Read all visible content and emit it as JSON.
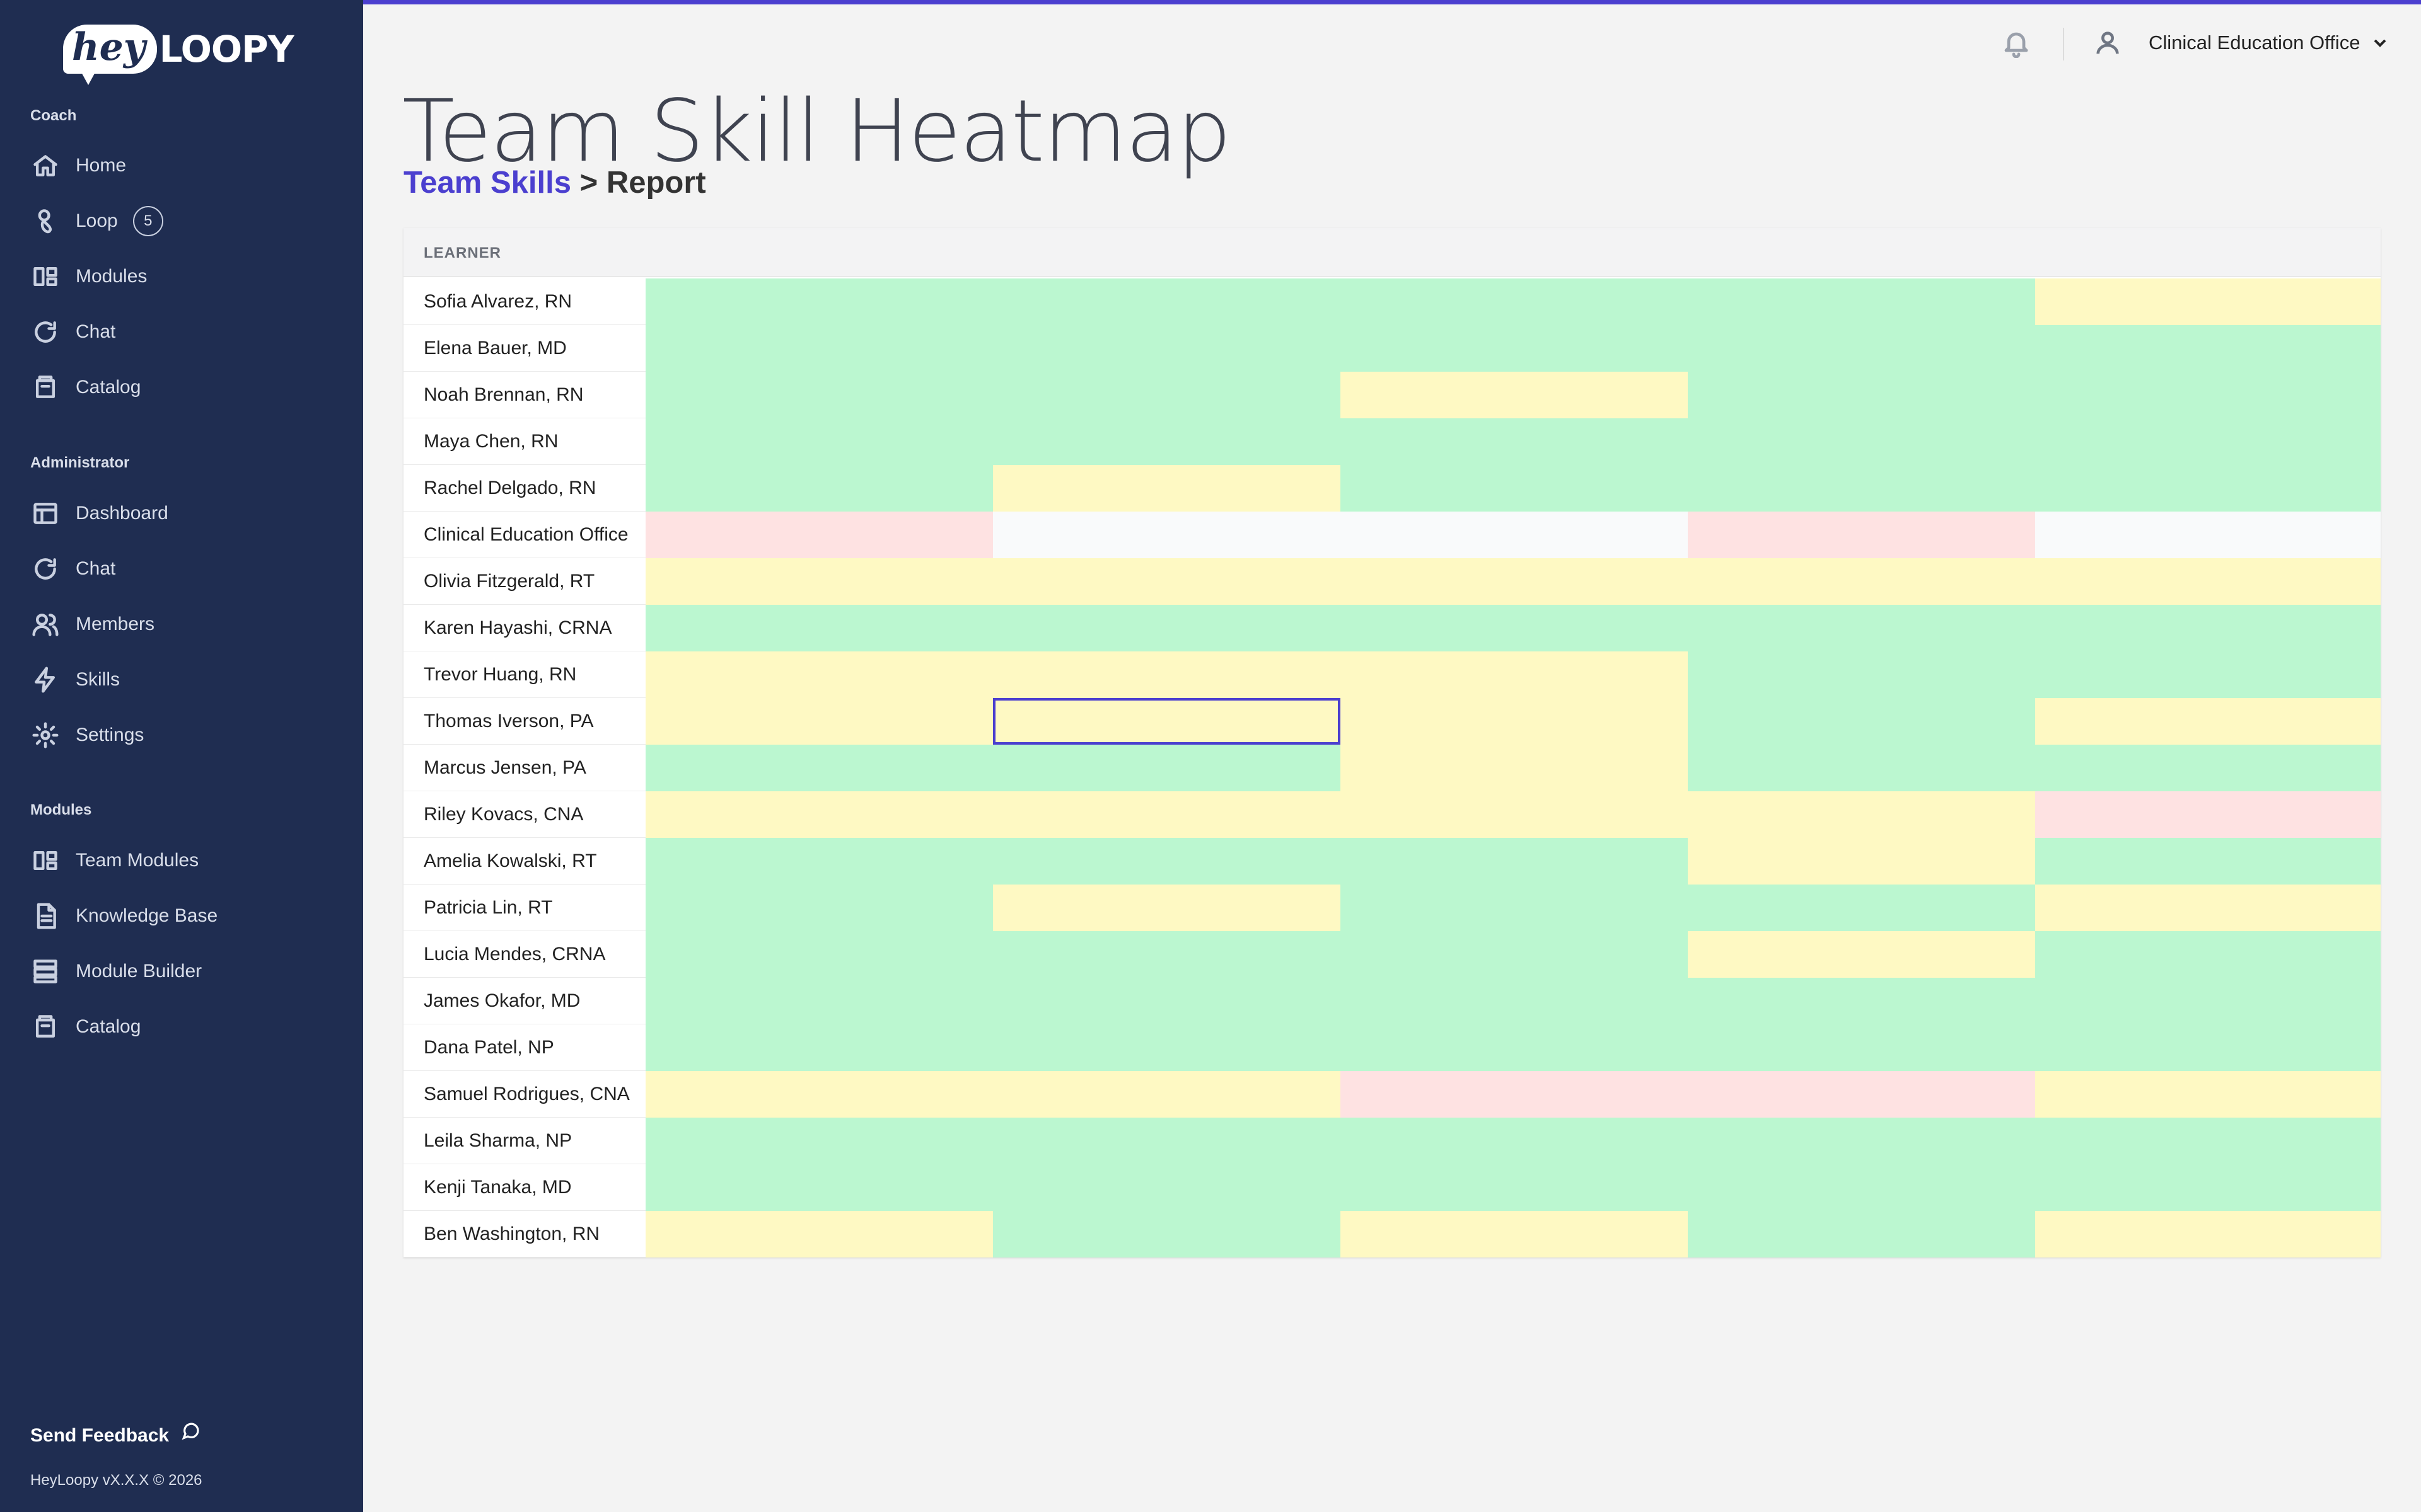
{
  "brand": {
    "hey": "hey",
    "loopy": "LOOPY"
  },
  "sidebar": {
    "sections": [
      {
        "label": "Coach",
        "items": [
          {
            "label": "Home",
            "icon": "home-icon"
          },
          {
            "label": "Loop",
            "icon": "loop-icon",
            "badge": "5"
          },
          {
            "label": "Modules",
            "icon": "modules-icon"
          },
          {
            "label": "Chat",
            "icon": "chat-icon"
          },
          {
            "label": "Catalog",
            "icon": "catalog-icon"
          }
        ]
      },
      {
        "label": "Administrator",
        "items": [
          {
            "label": "Dashboard",
            "icon": "dashboard-icon"
          },
          {
            "label": "Chat",
            "icon": "chat-icon"
          },
          {
            "label": "Members",
            "icon": "members-icon"
          },
          {
            "label": "Skills",
            "icon": "skills-icon"
          },
          {
            "label": "Settings",
            "icon": "gear-icon"
          }
        ]
      },
      {
        "label": "Modules",
        "items": [
          {
            "label": "Team Modules",
            "icon": "modules-icon"
          },
          {
            "label": "Knowledge Base",
            "icon": "document-icon"
          },
          {
            "label": "Module Builder",
            "icon": "builder-icon"
          },
          {
            "label": "Catalog",
            "icon": "catalog-icon"
          }
        ]
      }
    ],
    "feedback_label": "Send Feedback",
    "version": "HeyLoopy vX.X.X © 2026"
  },
  "header": {
    "account_name": "Clinical Education Office"
  },
  "page": {
    "title": "Team Skill Heatmap",
    "breadcrumb_link": "Team Skills",
    "breadcrumb_sep": " > ",
    "breadcrumb_current": "Report"
  },
  "colors": {
    "G": "#bbf7d0",
    "Y": "#fef9c3",
    "R": "#fee2e2",
    "E": "#f9fafb",
    "accent": "#4b3fcf",
    "sidebar": "#1f2d51"
  },
  "heatmap": {
    "learner_header": "LEARNER",
    "selected_cell": {
      "row": 9,
      "col": 1
    },
    "rows": [
      {
        "name": "Sofia Alvarez, RN",
        "cells": [
          "G",
          "G",
          "G",
          "G",
          "Y"
        ]
      },
      {
        "name": "Elena Bauer, MD",
        "cells": [
          "G",
          "G",
          "G",
          "G",
          "G"
        ]
      },
      {
        "name": "Noah Brennan, RN",
        "cells": [
          "G",
          "G",
          "Y",
          "G",
          "G"
        ]
      },
      {
        "name": "Maya Chen, RN",
        "cells": [
          "G",
          "G",
          "G",
          "G",
          "G"
        ]
      },
      {
        "name": "Rachel Delgado, RN",
        "cells": [
          "G",
          "Y",
          "G",
          "G",
          "G"
        ]
      },
      {
        "name": "Clinical Education Office",
        "cells": [
          "R",
          "E",
          "E",
          "R",
          "E"
        ]
      },
      {
        "name": "Olivia Fitzgerald, RT",
        "cells": [
          "Y",
          "Y",
          "Y",
          "Y",
          "Y"
        ]
      },
      {
        "name": "Karen Hayashi, CRNA",
        "cells": [
          "G",
          "G",
          "G",
          "G",
          "G"
        ]
      },
      {
        "name": "Trevor Huang, RN",
        "cells": [
          "Y",
          "Y",
          "Y",
          "G",
          "G"
        ]
      },
      {
        "name": "Thomas Iverson, PA",
        "cells": [
          "Y",
          "Y",
          "Y",
          "G",
          "Y"
        ]
      },
      {
        "name": "Marcus Jensen, PA",
        "cells": [
          "G",
          "G",
          "Y",
          "G",
          "G"
        ]
      },
      {
        "name": "Riley Kovacs, CNA",
        "cells": [
          "Y",
          "Y",
          "Y",
          "Y",
          "R"
        ]
      },
      {
        "name": "Amelia Kowalski, RT",
        "cells": [
          "G",
          "G",
          "G",
          "Y",
          "G"
        ]
      },
      {
        "name": "Patricia Lin, RT",
        "cells": [
          "G",
          "Y",
          "G",
          "G",
          "Y"
        ]
      },
      {
        "name": "Lucia Mendes, CRNA",
        "cells": [
          "G",
          "G",
          "G",
          "Y",
          "G"
        ]
      },
      {
        "name": "James Okafor, MD",
        "cells": [
          "G",
          "G",
          "G",
          "G",
          "G"
        ]
      },
      {
        "name": "Dana Patel, NP",
        "cells": [
          "G",
          "G",
          "G",
          "G",
          "G"
        ]
      },
      {
        "name": "Samuel Rodrigues, CNA",
        "cells": [
          "Y",
          "Y",
          "R",
          "R",
          "Y"
        ]
      },
      {
        "name": "Leila Sharma, NP",
        "cells": [
          "G",
          "G",
          "G",
          "G",
          "G"
        ]
      },
      {
        "name": "Kenji Tanaka, MD",
        "cells": [
          "G",
          "G",
          "G",
          "G",
          "G"
        ]
      },
      {
        "name": "Ben Washington, RN",
        "cells": [
          "Y",
          "G",
          "Y",
          "G",
          "Y"
        ]
      }
    ]
  }
}
